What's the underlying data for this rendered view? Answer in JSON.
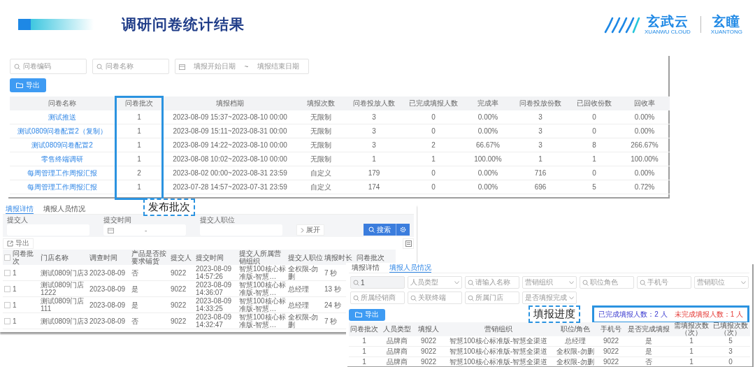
{
  "slide": {
    "title": "调研问卷统计结果"
  },
  "logo": {
    "brand": "玄武云",
    "brand_en": "XUANWU CLOUD",
    "product": "玄瞳",
    "product_en": "XUANTONG"
  },
  "survey_list": {
    "filters": [
      {
        "kind": "search",
        "placeholder": "问卷编码"
      },
      {
        "kind": "search",
        "placeholder": "问卷名称"
      },
      {
        "kind": "date_range",
        "start_placeholder": "填报开始日期",
        "separator": "~",
        "end_placeholder": "填报结束日期"
      }
    ],
    "export_button": "导出",
    "columns": [
      {
        "label": "问卷名称",
        "kind": "link",
        "highlighted": false
      },
      {
        "label": "问卷批次",
        "kind": "text",
        "highlighted": true
      },
      {
        "label": "填报档期",
        "kind": "text",
        "highlighted": false
      },
      {
        "label": "填报次数",
        "kind": "text",
        "highlighted": false
      },
      {
        "label": "问卷投放人数",
        "kind": "text",
        "highlighted": false
      },
      {
        "label": "已完成填报人数",
        "kind": "text",
        "highlighted": false
      },
      {
        "label": "完成率",
        "kind": "text",
        "highlighted": false
      },
      {
        "label": "问卷投放份数",
        "kind": "text",
        "highlighted": false
      },
      {
        "label": "已回收份数",
        "kind": "text",
        "highlighted": false
      },
      {
        "label": "回收率",
        "kind": "text",
        "highlighted": false
      }
    ],
    "rows": [
      [
        "测试推送",
        "1",
        "2023-08-09 15:37~2023-08-10 00:00",
        "无限制",
        "3",
        "0",
        "0.00%",
        "3",
        "0",
        "0.00%"
      ],
      [
        "测试0809问卷配置2（复制）",
        "1",
        "2023-08-09 15:11~2023-08-31 00:00",
        "无限制",
        "3",
        "0",
        "0.00%",
        "3",
        "0",
        "0.00%"
      ],
      [
        "测试0809问卷配置2",
        "1",
        "2023-08-09 14:22~2023-08-10 00:00",
        "无限制",
        "3",
        "2",
        "66.67%",
        "3",
        "8",
        "266.67%"
      ],
      [
        "零售终端调研",
        "1",
        "2023-08-08 10:02~2023-08-10 00:00",
        "无限制",
        "1",
        "1",
        "100.00%",
        "1",
        "1",
        "100.00%"
      ],
      [
        "每周管理工作周报汇报",
        "2",
        "2023-08-02 00:00~2023-08-31 23:59",
        "自定义",
        "179",
        "0",
        "0.00%",
        "716",
        "0",
        "0.00%"
      ],
      [
        "每周管理工作周报汇报",
        "1",
        "2023-07-28 14:57~2023-07-31 23:59",
        "自定义",
        "174",
        "0",
        "0.00%",
        "696",
        "5",
        "0.72%"
      ]
    ]
  },
  "callouts": [
    {
      "text": "发布批次"
    },
    {
      "text": "填报进度"
    }
  ],
  "detail": {
    "tabs": [
      {
        "label": "填报详情",
        "selected": true
      },
      {
        "label": "填报人员情况",
        "selected": false
      }
    ],
    "filters": [
      {
        "kind": "text",
        "label": "提交人"
      },
      {
        "kind": "date_range",
        "label": "提交时间",
        "separator": "-"
      },
      {
        "kind": "text",
        "label": "提交人职位"
      }
    ],
    "expand_button": "展开",
    "search_button": "搜索",
    "export_button": "导出",
    "select_all_checked": false,
    "columns": [
      "问卷批次",
      "门店名称",
      "调查时间",
      "产品是否按要求铺货",
      "提交人",
      "提交时间",
      "提交人所属营销组织",
      "提交人职位",
      "填报时长",
      "问卷批次"
    ],
    "rows": [
      {
        "checked": false,
        "cells": [
          "1",
          "测试0809门店3",
          "2023-08-09",
          "否",
          "9022",
          "2023-08-09 14:57:26",
          "智慧100核心标准版-智慧…",
          "全权限-勿删",
          "7 秒"
        ]
      },
      {
        "checked": false,
        "cells": [
          "1",
          "测试0809门店1222",
          "2023-08-09",
          "是",
          "9022",
          "2023-08-09 14:36:07",
          "智慧100核心标准版-智慧…",
          "总经理",
          "13 秒"
        ]
      },
      {
        "checked": false,
        "cells": [
          "1",
          "测试0809门店111",
          "2023-08-09",
          "是",
          "9022",
          "2023-08-09 14:33:25",
          "智慧100核心标准版-智慧…",
          "总经理",
          "24 秒"
        ]
      },
      {
        "checked": false,
        "cells": [
          "1",
          "测试0809门店3",
          "2023-08-09",
          "否",
          "9022",
          "2023-08-09 14:32:47",
          "智慧100核心标准版-智慧…",
          "全权限-勿删",
          "7 秒"
        ]
      }
    ]
  },
  "respondents": {
    "tabs": [
      {
        "label": "填报详情",
        "selected": false
      },
      {
        "label": "填报人员情况",
        "selected": true
      }
    ],
    "filters": [
      {
        "kind": "search",
        "value": "1"
      },
      {
        "kind": "select",
        "placeholder": "人员类型"
      },
      {
        "kind": "search",
        "placeholder": "请输入名称"
      },
      {
        "kind": "select",
        "placeholder": "营销组织"
      },
      {
        "kind": "search",
        "placeholder": "职位角色"
      },
      {
        "kind": "search",
        "placeholder": "手机号"
      },
      {
        "kind": "select",
        "placeholder": "营销职位"
      },
      {
        "kind": "search",
        "placeholder": "所属经销商"
      },
      {
        "kind": "search",
        "placeholder": "关联终端"
      },
      {
        "kind": "search",
        "placeholder": "所属门店"
      },
      {
        "kind": "select",
        "placeholder": "是否填报完成"
      }
    ],
    "export_button": "导出",
    "summary_highlighted": true,
    "summary": [
      {
        "text": "已完成填报人数：2 人",
        "kind": "completed"
      },
      {
        "text": "未完成填报人数：1 人",
        "kind": "pending"
      }
    ],
    "columns": [
      "问卷批次",
      "人员类型",
      "填报人",
      "营销组织",
      "职位/角色",
      "手机号",
      "是否完成填报",
      "需填报次数（次）",
      "已填报次数（次）"
    ],
    "rows": [
      [
        "1",
        "品牌商",
        "9022",
        "智慧100核心标准版-智慧全渠道",
        "总经理",
        "9022",
        "是",
        "1",
        "5"
      ],
      [
        "1",
        "品牌商",
        "9022",
        "智慧100核心标准版-智慧全渠道",
        "全权限-勿删",
        "9022",
        "是",
        "1",
        "3"
      ],
      [
        "1",
        "品牌商",
        "9022",
        "智慧100核心标准版-智慧全渠道",
        "全权限-勿删",
        "9022",
        "否",
        "1",
        "0"
      ]
    ]
  }
}
